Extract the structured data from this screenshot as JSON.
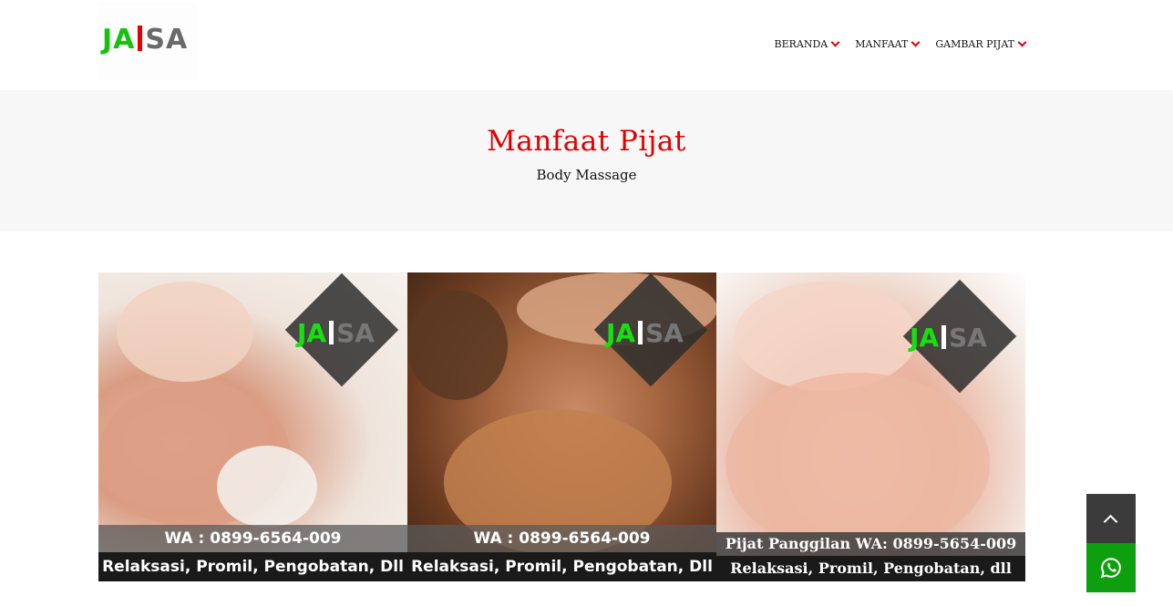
{
  "logo": {
    "part1": "JA",
    "part2": "SA"
  },
  "nav": {
    "items": [
      {
        "label": "BERANDA"
      },
      {
        "label": "MANFAAT"
      },
      {
        "label": "GAMBAR PIJAT"
      }
    ]
  },
  "banner": {
    "title": "Manfaat Pijat",
    "subtitle": "Body Massage"
  },
  "gallery": [
    {
      "watermark1": "JA",
      "watermark2": "SA",
      "caption_top": "WA : 0899-6564-009",
      "caption_bottom": "Relaksasi, Promil, Pengobatan, Dll"
    },
    {
      "watermark1": "JA",
      "watermark2": "SA",
      "caption_top": "WA : 0899-6564-009",
      "caption_bottom": "Relaksasi, Promil, Pengobatan, Dll"
    },
    {
      "watermark1": "JA",
      "watermark2": "SA",
      "caption_top": "Pijat Panggilan WA: 0899-5654-009",
      "caption_bottom": "Relaksasi, Promil, Pengobatan, dll"
    }
  ],
  "floating": {
    "top_icon": "chevron-up-icon",
    "wa_icon": "whatsapp-icon"
  },
  "colors": {
    "accent": "#e00000",
    "brand_green": "#17c20f",
    "wa_green": "#0e9f0e"
  }
}
